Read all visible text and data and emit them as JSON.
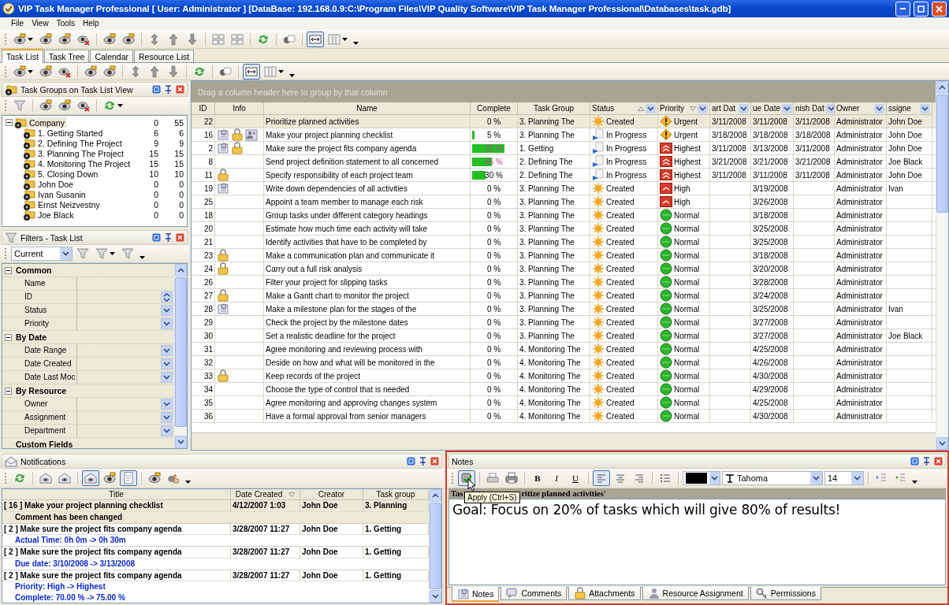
{
  "window": {
    "title": "VIP Task Manager Professional [ User: Administrator ] [DataBase: 192.168.0.9:C:\\Program Files\\VIP Quality Software\\VIP Task Manager Professional\\Databases\\task.gdb]"
  },
  "menu": [
    "File",
    "View",
    "Tools",
    "Help"
  ],
  "main_toolbar": [
    {
      "kind": "dropdown_button",
      "pressed": false
    },
    {
      "kind": "button",
      "pressed": false
    },
    {
      "kind": "button",
      "pressed": false
    },
    {
      "kind": "button",
      "pressed": false
    },
    {
      "kind": "separator"
    },
    {
      "kind": "button",
      "pressed": false
    },
    {
      "kind": "button",
      "pressed": false
    },
    {
      "kind": "separator"
    },
    {
      "kind": "button",
      "pressed": false
    },
    {
      "kind": "button",
      "pressed": false
    },
    {
      "kind": "button",
      "pressed": false
    },
    {
      "kind": "separator"
    },
    {
      "kind": "button",
      "pressed": false
    },
    {
      "kind": "button",
      "pressed": false
    },
    {
      "kind": "separator"
    },
    {
      "kind": "button",
      "pressed": false
    },
    {
      "kind": "separator"
    },
    {
      "kind": "button",
      "pressed": false
    },
    {
      "kind": "separator"
    },
    {
      "kind": "button",
      "pressed": true
    },
    {
      "kind": "dropdown_button",
      "pressed": false
    },
    {
      "kind": "more"
    }
  ],
  "view_tabs": [
    {
      "label": "Task List",
      "selected": true
    },
    {
      "label": "Task Tree",
      "selected": false
    },
    {
      "label": "Calendar",
      "selected": false
    },
    {
      "label": "Resource List",
      "selected": false
    }
  ],
  "view_toolbar": [
    {
      "kind": "dropdown_button",
      "pressed": false
    },
    {
      "kind": "button",
      "pressed": false
    },
    {
      "kind": "button",
      "pressed": false
    },
    {
      "kind": "separator"
    },
    {
      "kind": "button",
      "pressed": false
    },
    {
      "kind": "button",
      "pressed": false
    },
    {
      "kind": "separator"
    },
    {
      "kind": "button",
      "pressed": false
    },
    {
      "kind": "button",
      "pressed": false
    },
    {
      "kind": "button",
      "pressed": false
    },
    {
      "kind": "separator"
    },
    {
      "kind": "button",
      "pressed": false
    },
    {
      "kind": "separator"
    },
    {
      "kind": "button",
      "pressed": false
    },
    {
      "kind": "separator"
    },
    {
      "kind": "button",
      "pressed": true
    },
    {
      "kind": "dropdown_button",
      "pressed": false
    },
    {
      "kind": "more"
    }
  ],
  "task_groups": {
    "title": "Task Groups on Task List View",
    "toolbar": [
      {
        "kind": "button",
        "pressed": false
      },
      {
        "kind": "separator"
      },
      {
        "kind": "button",
        "pressed": false
      },
      {
        "kind": "button",
        "pressed": false
      },
      {
        "kind": "button",
        "pressed": false
      },
      {
        "kind": "separator"
      },
      {
        "kind": "dropdown_button",
        "pressed": false
      }
    ],
    "tree": [
      {
        "label": "Company",
        "open_count": "0",
        "total_count": "55",
        "selected": true,
        "expanded": true,
        "children": [
          {
            "label": "1. Getting Started",
            "open_count": "6",
            "total_count": "6",
            "selected": false
          },
          {
            "label": "2. Defining The Project",
            "open_count": "9",
            "total_count": "9",
            "selected": false
          },
          {
            "label": "3. Planning The Project",
            "open_count": "15",
            "total_count": "15",
            "selected": false
          },
          {
            "label": "4. Monitoring The Project",
            "open_count": "15",
            "total_count": "15",
            "selected": false
          },
          {
            "label": "5. Closing Down",
            "open_count": "10",
            "total_count": "10",
            "selected": false
          },
          {
            "label": "John Doe",
            "open_count": "0",
            "total_count": "0",
            "selected": false
          },
          {
            "label": "Ivan Susanin",
            "open_count": "0",
            "total_count": "0",
            "selected": false
          },
          {
            "label": "Ernst Neizvestny",
            "open_count": "0",
            "total_count": "0",
            "selected": false
          },
          {
            "label": "Joe Black",
            "open_count": "0",
            "total_count": "0",
            "selected": false
          }
        ]
      }
    ]
  },
  "filters": {
    "title": "Filters - Task List",
    "preset": "Current",
    "toolbar": [
      {
        "kind": "button",
        "pressed": false
      },
      {
        "kind": "dropdown_button",
        "pressed": false
      },
      {
        "kind": "button",
        "pressed": false
      },
      {
        "kind": "more"
      }
    ],
    "sections": [
      {
        "label": "Common",
        "expanded": true,
        "fields": [
          {
            "label": "Name",
            "kind": "text"
          },
          {
            "label": "ID",
            "kind": "spin"
          },
          {
            "label": "Status",
            "kind": "dropdown"
          },
          {
            "label": "Priority",
            "kind": "dropdown"
          }
        ]
      },
      {
        "label": "By Date",
        "expanded": true,
        "fields": [
          {
            "label": "Date Range",
            "kind": "dropdown"
          },
          {
            "label": "Date Created",
            "kind": "dropdown"
          },
          {
            "label": "Date Last Moc",
            "kind": "dropdown"
          }
        ]
      },
      {
        "label": "By Resource",
        "expanded": true,
        "fields": [
          {
            "label": "Owner",
            "kind": "dropdown"
          },
          {
            "label": "Assignment",
            "kind": "dropdown"
          },
          {
            "label": "Department",
            "kind": "dropdown"
          }
        ]
      },
      {
        "label": "Custom Fields",
        "expanded": false
      }
    ]
  },
  "task_grid": {
    "group_hint": "Drag a column header here to group by that column",
    "columns": [
      {
        "label": "ID",
        "sort_ascending": false,
        "sort_descending": false,
        "filter_button": false
      },
      {
        "label": "Info",
        "sort_ascending": false,
        "sort_descending": false,
        "filter_button": false
      },
      {
        "label": "Name",
        "sort_ascending": false,
        "sort_descending": false,
        "filter_button": false
      },
      {
        "label": "Complete",
        "sort_ascending": false,
        "sort_descending": false,
        "filter_button": false
      },
      {
        "label": "Task Group",
        "sort_ascending": false,
        "sort_descending": false,
        "filter_button": false
      },
      {
        "label": "Status",
        "sort_ascending": true,
        "sort_descending": false,
        "filter_button": true
      },
      {
        "label": "Priority",
        "sort_ascending": false,
        "sort_descending": true,
        "filter_button": true
      },
      {
        "label": "art Dat",
        "sort_ascending": false,
        "sort_descending": false,
        "filter_button": true
      },
      {
        "label": "ue Date",
        "sort_ascending": false,
        "sort_descending": false,
        "filter_button": true
      },
      {
        "label": "nish Dat",
        "sort_ascending": false,
        "sort_descending": false,
        "filter_button": true
      },
      {
        "label": "Owner",
        "sort_ascending": false,
        "sort_descending": false,
        "filter_button": true
      },
      {
        "label": "ssigne",
        "sort_ascending": false,
        "sort_descending": false,
        "filter_button": true
      }
    ],
    "rows": [
      {
        "id": "22",
        "info": [],
        "name": "Prioritize planned activities",
        "complete": "0 %",
        "level": 0,
        "task_group": "3. Planning The",
        "status": {
          "kind": "created",
          "label": "Created"
        },
        "priority": {
          "kind": "urgent",
          "label": "Urgent"
        },
        "start": "3/11/2008",
        "due": "3/11/2008",
        "finish": "3/11/2008",
        "owner": "Administrator",
        "assignee": "John Doe",
        "selected": true
      },
      {
        "id": "16",
        "info": [
          {
            "kind": "note"
          },
          {
            "kind": "attachment"
          },
          {
            "kind": "resources"
          }
        ],
        "name": "Make your project planning checklist",
        "complete": "5 %",
        "level": 0.05,
        "task_group": "3. Planning The",
        "status": {
          "kind": "in_progress",
          "label": "In Progress"
        },
        "priority": {
          "kind": "urgent",
          "label": "Urgent"
        },
        "start": "3/18/2008",
        "due": "3/18/2008",
        "finish": "3/18/2008",
        "owner": "Administrator",
        "assignee": "John Doe",
        "selected": false
      },
      {
        "id": "2",
        "info": [
          {
            "kind": "note"
          },
          {
            "kind": "attachment"
          }
        ],
        "name": "Make sure the project fits company agenda",
        "complete": "75 %",
        "level": 0.75,
        "task_group": "1. Getting",
        "status": {
          "kind": "in_progress",
          "label": "In Progress"
        },
        "priority": {
          "kind": "highest",
          "label": "Highest"
        },
        "start": "3/11/2008",
        "due": "3/13/2008",
        "finish": "3/11/2008",
        "owner": "Administrator",
        "assignee": "John Doe",
        "selected": false
      },
      {
        "id": "8",
        "info": [],
        "name": "Send project definition statement to all concerned",
        "complete": "45 %",
        "level": 0.45,
        "task_group": "2. Defining The",
        "status": {
          "kind": "in_progress",
          "label": "In Progress"
        },
        "priority": {
          "kind": "highest",
          "label": "Highest"
        },
        "start": "3/21/2008",
        "due": "3/21/2008",
        "finish": "3/21/2008",
        "owner": "Administrator",
        "assignee": "Joe Black",
        "selected": false
      },
      {
        "id": "11",
        "info": [
          {
            "kind": "attachment"
          }
        ],
        "name": "Specify responsibility of each project team",
        "complete": "30 %",
        "level": 0.3,
        "task_group": "2. Defining The",
        "status": {
          "kind": "in_progress",
          "label": "In Progress"
        },
        "priority": {
          "kind": "highest",
          "label": "Highest"
        },
        "start": "3/11/2008",
        "due": "3/11/2008",
        "finish": "3/11/2008",
        "owner": "Administrator",
        "assignee": "John Doe",
        "selected": false
      },
      {
        "id": "19",
        "info": [
          {
            "kind": "note"
          }
        ],
        "name": "Write down dependencies of all activities",
        "complete": "0 %",
        "level": 0,
        "task_group": "3. Planning The",
        "status": {
          "kind": "created",
          "label": "Created"
        },
        "priority": {
          "kind": "high",
          "label": "High"
        },
        "due": "3/19/2008",
        "owner": "Administrator",
        "assignee": "Ivan",
        "selected": false
      },
      {
        "id": "25",
        "info": [],
        "name": "Appoint a team member to manage each risk",
        "complete": "0 %",
        "level": 0,
        "task_group": "3. Planning The",
        "status": {
          "kind": "created",
          "label": "Created"
        },
        "priority": {
          "kind": "high",
          "label": "High"
        },
        "due": "3/26/2008",
        "owner": "Administrator",
        "selected": false
      },
      {
        "id": "18",
        "info": [],
        "name": "Group tasks under different category headings",
        "complete": "0 %",
        "level": 0,
        "task_group": "3. Planning The",
        "status": {
          "kind": "created",
          "label": "Created"
        },
        "priority": {
          "kind": "normal",
          "label": "Normal"
        },
        "due": "3/18/2008",
        "owner": "Administrator",
        "selected": false
      },
      {
        "id": "20",
        "info": [],
        "name": "Estimate how much time each activity will take",
        "complete": "0 %",
        "level": 0,
        "task_group": "3. Planning The",
        "status": {
          "kind": "created",
          "label": "Created"
        },
        "priority": {
          "kind": "normal",
          "label": "Normal"
        },
        "due": "3/25/2008",
        "owner": "Administrator",
        "selected": false
      },
      {
        "id": "21",
        "info": [],
        "name": "Identify activities that have to be completed by",
        "complete": "0 %",
        "level": 0,
        "task_group": "3. Planning The",
        "status": {
          "kind": "created",
          "label": "Created"
        },
        "priority": {
          "kind": "normal",
          "label": "Normal"
        },
        "due": "3/25/2008",
        "owner": "Administrator",
        "selected": false
      },
      {
        "id": "23",
        "info": [
          {
            "kind": "attachment"
          }
        ],
        "name": "Make a communication plan and communicate it",
        "complete": "0 %",
        "level": 0,
        "task_group": "3. Planning The",
        "status": {
          "kind": "created",
          "label": "Created"
        },
        "priority": {
          "kind": "normal",
          "label": "Normal"
        },
        "due": "3/18/2008",
        "owner": "Administrator",
        "selected": false
      },
      {
        "id": "24",
        "info": [
          {
            "kind": "attachment"
          }
        ],
        "name": "Carry out a full risk analysis",
        "complete": "0 %",
        "level": 0,
        "task_group": "3. Planning The",
        "status": {
          "kind": "created",
          "label": "Created"
        },
        "priority": {
          "kind": "normal",
          "label": "Normal"
        },
        "due": "3/20/2008",
        "owner": "Administrator",
        "selected": false
      },
      {
        "id": "26",
        "info": [],
        "name": "Filter your project for slipping tasks",
        "complete": "0 %",
        "level": 0,
        "task_group": "3. Planning The",
        "status": {
          "kind": "created",
          "label": "Created"
        },
        "priority": {
          "kind": "normal",
          "label": "Normal"
        },
        "due": "3/28/2008",
        "owner": "Administrator",
        "selected": false
      },
      {
        "id": "27",
        "info": [
          {
            "kind": "attachment"
          }
        ],
        "name": "Make a Gantt chart to monitor the project",
        "complete": "0 %",
        "level": 0,
        "task_group": "3. Planning The",
        "status": {
          "kind": "created",
          "label": "Created"
        },
        "priority": {
          "kind": "normal",
          "label": "Normal"
        },
        "due": "3/24/2008",
        "owner": "Administrator",
        "selected": false
      },
      {
        "id": "28",
        "info": [
          {
            "kind": "note"
          }
        ],
        "name": "Make a milestone plan for the stages of the",
        "complete": "0 %",
        "level": 0,
        "task_group": "3. Planning The",
        "status": {
          "kind": "created",
          "label": "Created"
        },
        "priority": {
          "kind": "normal",
          "label": "Normal"
        },
        "due": "3/25/2008",
        "owner": "Administrator",
        "assignee": "Ivan",
        "selected": false
      },
      {
        "id": "29",
        "info": [],
        "name": "Check the project by the milestone dates",
        "complete": "0 %",
        "level": 0,
        "task_group": "3. Planning The",
        "status": {
          "kind": "created",
          "label": "Created"
        },
        "priority": {
          "kind": "normal",
          "label": "Normal"
        },
        "due": "3/27/2008",
        "owner": "Administrator",
        "selected": false
      },
      {
        "id": "30",
        "info": [],
        "name": "Set a realistic deadline for the project",
        "complete": "0 %",
        "level": 0,
        "task_group": "3. Planning The",
        "status": {
          "kind": "created",
          "label": "Created"
        },
        "priority": {
          "kind": "normal",
          "label": "Normal"
        },
        "due": "3/27/2008",
        "owner": "Administrator",
        "assignee": "Joe Black",
        "selected": false
      },
      {
        "id": "31",
        "info": [],
        "name": "Agree monitoring and reviewing process with",
        "complete": "0 %",
        "level": 0,
        "task_group": "4. Monitoring The",
        "status": {
          "kind": "created",
          "label": "Created"
        },
        "priority": {
          "kind": "normal",
          "label": "Normal"
        },
        "due": "4/25/2008",
        "owner": "Administrator",
        "selected": false
      },
      {
        "id": "32",
        "info": [],
        "name": "Deside on how and what will be monitored in the",
        "complete": "0 %",
        "level": 0,
        "task_group": "4. Monitoring The",
        "status": {
          "kind": "created",
          "label": "Created"
        },
        "priority": {
          "kind": "normal",
          "label": "Normal"
        },
        "due": "4/26/2008",
        "owner": "Administrator",
        "selected": false
      },
      {
        "id": "33",
        "info": [
          {
            "kind": "attachment"
          }
        ],
        "name": "Keep records of the project",
        "complete": "0 %",
        "level": 0,
        "task_group": "4. Monitoring The",
        "status": {
          "kind": "created",
          "label": "Created"
        },
        "priority": {
          "kind": "normal",
          "label": "Normal"
        },
        "due": "4/30/2008",
        "owner": "Administrator",
        "selected": false
      },
      {
        "id": "34",
        "info": [],
        "name": "Choose the type of control that is needed",
        "complete": "0 %",
        "level": 0,
        "task_group": "4. Monitoring The",
        "status": {
          "kind": "created",
          "label": "Created"
        },
        "priority": {
          "kind": "normal",
          "label": "Normal"
        },
        "due": "4/29/2008",
        "owner": "Administrator",
        "selected": false
      },
      {
        "id": "35",
        "info": [],
        "name": "Agree monitoring and approving changes system",
        "complete": "0 %",
        "level": 0,
        "task_group": "4. Monitoring The",
        "status": {
          "kind": "created",
          "label": "Created"
        },
        "priority": {
          "kind": "normal",
          "label": "Normal"
        },
        "due": "4/25/2008",
        "owner": "Administrator",
        "selected": false
      },
      {
        "id": "36",
        "info": [],
        "name": "Have a formal approval from senior managers",
        "complete": "0 %",
        "level": 0,
        "task_group": "4. Monitoring The",
        "status": {
          "kind": "created",
          "label": "Created"
        },
        "priority": {
          "kind": "normal",
          "label": "Normal"
        },
        "due": "4/30/2008",
        "owner": "Administrator",
        "selected": false
      }
    ]
  },
  "notifications": {
    "title": "Notifications",
    "toolbar": [
      {
        "kind": "button",
        "pressed": false
      },
      {
        "kind": "separator"
      },
      {
        "kind": "button",
        "pressed": false
      },
      {
        "kind": "button",
        "pressed": false
      },
      {
        "kind": "separator"
      },
      {
        "kind": "button",
        "pressed": true
      },
      {
        "kind": "button",
        "pressed": false
      },
      {
        "kind": "button",
        "pressed": true
      },
      {
        "kind": "separator"
      },
      {
        "kind": "button",
        "pressed": false
      },
      {
        "kind": "button",
        "pressed": false
      },
      {
        "kind": "more"
      }
    ],
    "columns": [
      {
        "label": "Title",
        "sort_descending": false
      },
      {
        "label": "Date Created",
        "sort_descending": true
      },
      {
        "label": "Creator",
        "sort_descending": false
      },
      {
        "label": "Task group",
        "sort_descending": false
      }
    ],
    "items": [
      {
        "title": "[ 16 ] Make your project planning checklist",
        "date": "4/12/2007 1:03",
        "creator": "John Doe",
        "task_group": "3. Planning",
        "details": [
          "Comment has been changed"
        ],
        "selected": true
      },
      {
        "title": "[ 2 ] Make sure the project fits company agenda",
        "date": "3/28/2007 11:27",
        "creator": "John Doe",
        "task_group": "1. Getting",
        "details": [
          "Actual Time: 0h 0m -> 0h 30m"
        ],
        "selected": false
      },
      {
        "title": "[ 2 ] Make sure the project fits company agenda",
        "date": "3/28/2007 11:27",
        "creator": "John Doe",
        "task_group": "1. Getting",
        "details": [
          "Due date: 3/10/2008 -> 3/13/2008"
        ],
        "selected": false
      },
      {
        "title": "[ 2 ] Make sure the project fits company agenda",
        "date": "3/28/2007 11:27",
        "creator": "John Doe",
        "task_group": "1. Getting",
        "details": [
          "Priority: High -> Highest",
          "Complete: 70.00 % -> 75.00 %"
        ],
        "selected": false
      }
    ]
  },
  "notes": {
    "title": "Notes",
    "toolbar": [
      {
        "kind": "button",
        "pressed": true
      },
      {
        "kind": "separator"
      },
      {
        "kind": "button",
        "pressed": false
      },
      {
        "kind": "button",
        "pressed": false
      },
      {
        "kind": "separator"
      },
      {
        "kind": "text_button",
        "label": "B",
        "pressed": false
      },
      {
        "kind": "text_button",
        "label": "I",
        "pressed": false
      },
      {
        "kind": "text_button",
        "label": "U",
        "pressed": false
      },
      {
        "kind": "separator"
      },
      {
        "kind": "button",
        "pressed": true
      },
      {
        "kind": "button",
        "pressed": false
      },
      {
        "kind": "button",
        "pressed": false
      },
      {
        "kind": "separator"
      },
      {
        "kind": "button",
        "pressed": false
      },
      {
        "kind": "separator"
      },
      {
        "kind": "color_picker",
        "color": "#000000"
      },
      {
        "kind": "font_picker",
        "value": "Tahoma"
      },
      {
        "kind": "size_picker",
        "value": "14"
      },
      {
        "kind": "separator"
      },
      {
        "kind": "button",
        "pressed": false
      },
      {
        "kind": "button",
        "pressed": false
      },
      {
        "kind": "more"
      }
    ],
    "subject_parts": [
      "Tas",
      "ritize planned activities'"
    ],
    "tooltip": "Apply (Ctrl+S)",
    "text": "Goal: Focus on 20% of tasks which will give 80% of results!",
    "tabs": [
      {
        "label": "Notes",
        "selected": true
      },
      {
        "label": "Comments",
        "selected": false
      },
      {
        "label": "Attachments",
        "selected": false
      },
      {
        "label": "Resource Assignment",
        "selected": false
      },
      {
        "label": "Permissions",
        "selected": false
      }
    ]
  }
}
